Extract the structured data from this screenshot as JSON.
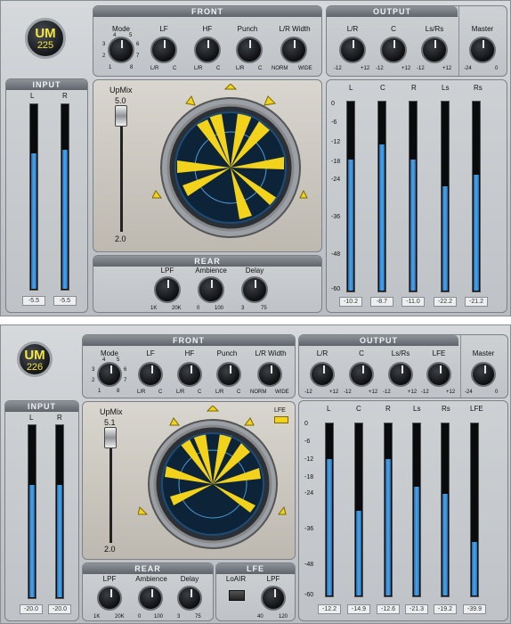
{
  "plugin1": {
    "logo_top": "UM",
    "logo_bottom": "225",
    "front_title": "FRONT",
    "output_title": "OUTPUT",
    "input_title": "INPUT",
    "rear_title": "REAR",
    "mode_label": "Mode",
    "mode_ticks": [
      "4",
      "5",
      "3",
      "6",
      "2",
      "7",
      "1",
      "8"
    ],
    "lf_label": "LF",
    "hf_label": "HF",
    "punch_label": "Punch",
    "lrwidth_label": "L/R Width",
    "lr": "L/R",
    "c": "C",
    "norm": "NORM",
    "wide": "WIDE",
    "out_knobs": [
      "L/R",
      "C",
      "Ls/Rs"
    ],
    "master_label": "Master",
    "m12": "-12",
    "p12": "+12",
    "m24": "-24",
    "zero": "0",
    "upmix_label": "UpMix",
    "upmix_value": "5.0",
    "upmix_min": "2.0",
    "rear_knobs": [
      "LPF",
      "Ambience",
      "Delay"
    ],
    "lpf_min": "1K",
    "lpf_max": "20K",
    "amb_min": "0",
    "amb_max": "100",
    "delay_min": "3",
    "delay_max": "75",
    "input_channels": [
      "L",
      "R"
    ],
    "input_levels": [
      0.74,
      0.76
    ],
    "input_readouts": [
      "-5.5",
      "-5.5"
    ],
    "output_channels": [
      "L",
      "C",
      "R",
      "Ls",
      "Rs"
    ],
    "output_levels": [
      0.7,
      0.78,
      0.7,
      0.56,
      0.62
    ],
    "output_readouts": [
      "-10.2",
      "-8.7",
      "-11.0",
      "-22.2",
      "-21.2"
    ],
    "scale": [
      "0",
      "-6",
      "-12",
      "-18",
      "-24",
      "-36",
      "-48",
      "-60"
    ]
  },
  "plugin2": {
    "logo_top": "UM",
    "logo_bottom": "226",
    "front_title": "FRONT",
    "output_title": "OUTPUT",
    "input_title": "INPUT",
    "rear_title": "REAR",
    "lfe_title": "LFE",
    "mode_label": "Mode",
    "mode_ticks": [
      "4",
      "5",
      "3",
      "6",
      "2",
      "7",
      "1",
      "8"
    ],
    "lf_label": "LF",
    "hf_label": "HF",
    "punch_label": "Punch",
    "lrwidth_label": "L/R Width",
    "lr": "L/R",
    "c": "C",
    "norm": "NORM",
    "wide": "WIDE",
    "out_knobs": [
      "L/R",
      "C",
      "Ls/Rs",
      "LFE"
    ],
    "master_label": "Master",
    "m12": "-12",
    "p12": "+12",
    "m24": "-24",
    "zero": "0",
    "upmix_label": "UpMix",
    "upmix_value": "5.1",
    "upmix_min": "2.0",
    "lfe_tag": "LFE",
    "rear_knobs": [
      "LPF",
      "Ambience",
      "Delay"
    ],
    "lpf_min": "1K",
    "lpf_max": "20K",
    "amb_min": "0",
    "amb_max": "100",
    "delay_min": "3",
    "delay_max": "75",
    "loair_label": "LoAIR",
    "lfe_lpf_label": "LPF",
    "lfe_lpf_min": "40",
    "lfe_lpf_max": "120",
    "input_channels": [
      "L",
      "R"
    ],
    "input_levels": [
      0.66,
      0.66
    ],
    "input_readouts": [
      "-20.0",
      "-20.0"
    ],
    "output_channels": [
      "L",
      "C",
      "R",
      "Ls",
      "Rs",
      "LFE"
    ],
    "output_levels": [
      0.8,
      0.5,
      0.8,
      0.64,
      0.6,
      0.32
    ],
    "output_readouts": [
      "-12.2",
      "-14.9",
      "-12.6",
      "-21.3",
      "-19.2",
      "-39.9"
    ],
    "scale": [
      "0",
      "-6",
      "-12",
      "-18",
      "-24",
      "-36",
      "-48",
      "-60"
    ]
  },
  "colors": {
    "meter_fill": "#3b93d8",
    "display_yellow": "#f2d21a",
    "logo_text": "#f5e642"
  }
}
